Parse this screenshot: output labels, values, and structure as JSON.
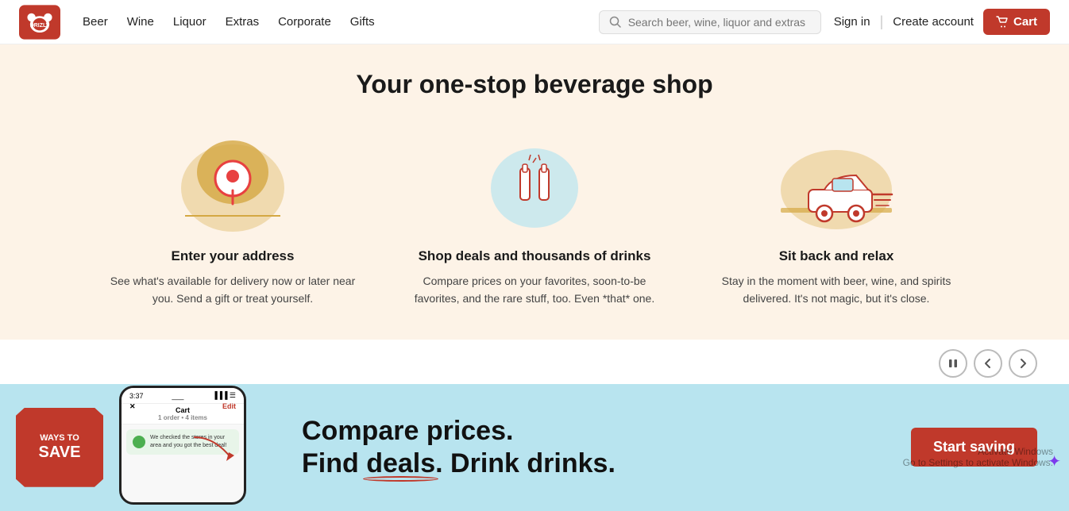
{
  "navbar": {
    "logo_alt": "Drizly",
    "nav_items": [
      {
        "label": "Beer",
        "id": "beer"
      },
      {
        "label": "Wine",
        "id": "wine"
      },
      {
        "label": "Liquor",
        "id": "liquor"
      },
      {
        "label": "Extras",
        "id": "extras"
      },
      {
        "label": "Corporate",
        "id": "corporate"
      },
      {
        "label": "Gifts",
        "id": "gifts"
      }
    ],
    "search_placeholder": "Search beer, wine, liquor and extras",
    "sign_in": "Sign in",
    "create_account": "Create account",
    "cart_label": "Cart"
  },
  "hero": {
    "title": "Your one-stop beverage shop",
    "features": [
      {
        "id": "address",
        "title": "Enter your address",
        "desc": "See what's available for delivery now or later near you. Send a gift or treat yourself."
      },
      {
        "id": "deals",
        "title": "Shop deals and thousands of drinks",
        "desc": "Compare prices on your favorites, soon-to-be favorites, and the rare stuff, too. Even *that* one."
      },
      {
        "id": "relax",
        "title": "Sit back and relax",
        "desc": "Stay in the moment with beer, wine, and spirits delivered. It's not magic, but it's close."
      }
    ]
  },
  "banner": {
    "ways_to_save_line1": "WAYS TO",
    "ways_to_save_line2": "SAVE",
    "phone": {
      "time": "3:37",
      "cart_title": "Cart",
      "cart_subtitle": "1 order • 4 items",
      "edit_label": "Edit",
      "message": "We checked the stores in your area and you got the best deal!"
    },
    "headline_line1": "Compare prices.",
    "headline_line2": "Find deals. Drink drinks.",
    "cta_label": "Start saving"
  },
  "activate_windows": {
    "line1": "Activate Windows",
    "line2": "Go to Settings to activate Windows."
  }
}
